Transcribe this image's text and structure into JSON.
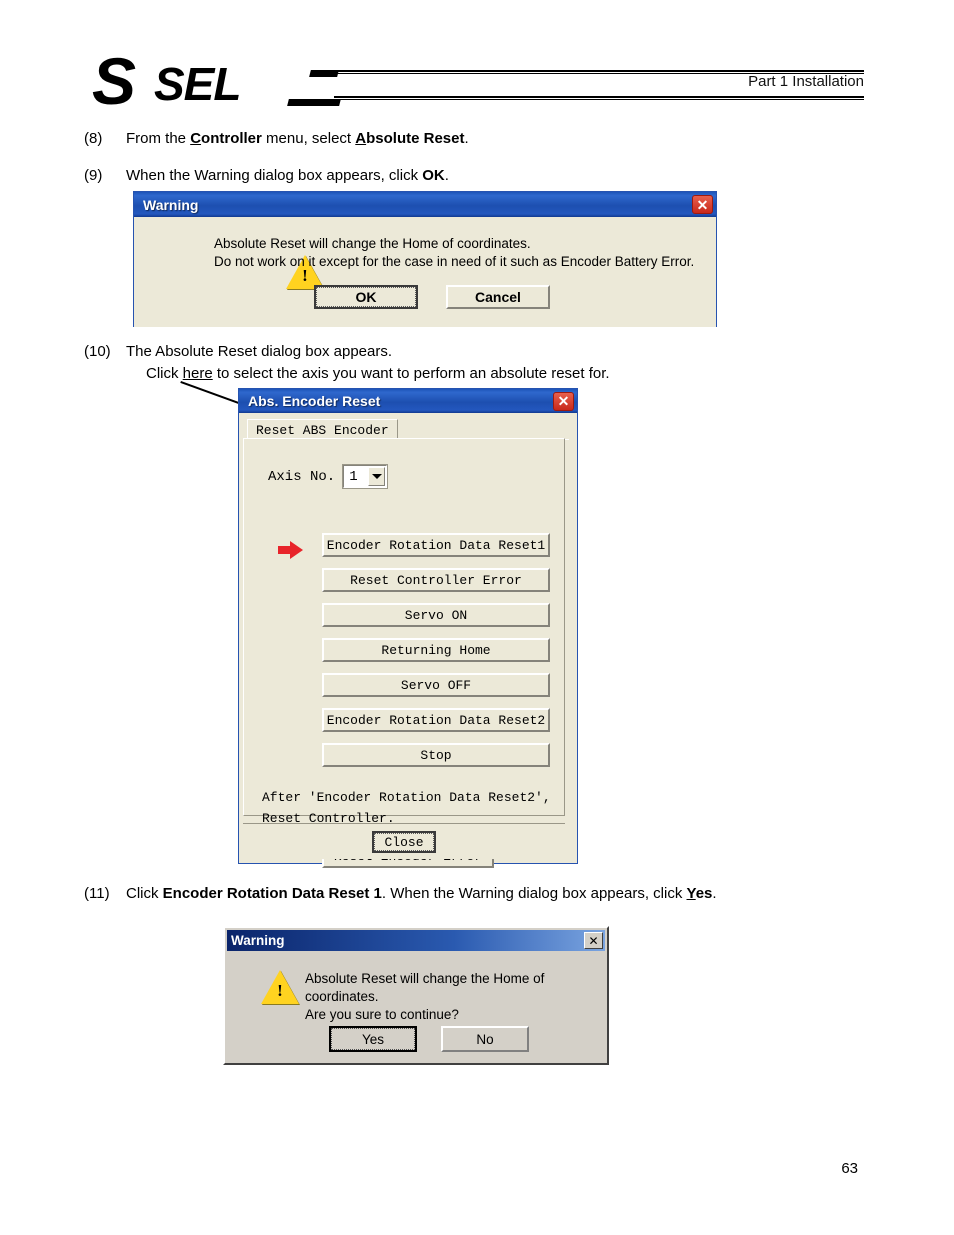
{
  "header": {
    "logo_s": "S",
    "logo_sel": "SEL",
    "section_title": "Part 1 Installation"
  },
  "steps": {
    "s8": {
      "num": "(8)",
      "part1": "From the ",
      "bold1": "C",
      "bold1b": "ontroller",
      "part2": " menu, select ",
      "bold2": "A",
      "bold2b": "bsolute Reset",
      "part3": "."
    },
    "s9": {
      "num": "(9)",
      "part1": "When the Warning dialog box appears, click ",
      "bold1": "OK",
      "part2": "."
    },
    "s10": {
      "num": "(10)",
      "line1": "The Absolute Reset dialog box appears.",
      "line2a": "Click ",
      "line2b": "here",
      "line2c": " to select the axis you want to perform an absolute reset for."
    },
    "s11": {
      "num": "(11)",
      "part1": "Click ",
      "bold1": "Encoder Rotation Data Reset 1",
      "part2": ". When the Warning dialog box appears, click ",
      "bold2a": "Y",
      "bold2b": "es",
      "part3": "."
    }
  },
  "warning1": {
    "title": "Warning",
    "close_label": "✕",
    "message_line1": "Absolute Reset will change the Home of coordinates.",
    "message_line2": "Do not work on it except for the case in need of it such as Encoder Battery Error.",
    "ok_label": "OK",
    "cancel_label": "Cancel"
  },
  "abs_dialog": {
    "title": "Abs. Encoder Reset",
    "close_label": "✕",
    "tab_label": "Reset ABS Encoder",
    "axis_label": "Axis No.",
    "axis_value": "1",
    "buttons": [
      "Encoder Rotation Data Reset1",
      "Reset Controller Error",
      "Servo ON",
      "Returning Home",
      "Servo OFF",
      "Encoder Rotation Data Reset2",
      "Stop"
    ],
    "note_line1": "After 'Encoder Rotation Data Reset2',",
    "note_line2": "Reset Controller.",
    "reset_encoder_error_label": "Reset Encoder Error",
    "close_button_label": "Close"
  },
  "warning2": {
    "title": "Warning",
    "close_label": "✕",
    "message_line1": "Absolute Reset will change the Home of coordinates.",
    "message_line2": "Are you sure to continue?",
    "yes_label": "Yes",
    "no_label": "No"
  },
  "page_number": "63",
  "colors": {
    "dialog_face": "#ece9d8",
    "classic_face": "#d4d0c8",
    "title_blue": "#1d54b8",
    "close_red": "#c8281a",
    "warn_yellow": "#ffd320",
    "arrow_red": "#e8242a"
  }
}
